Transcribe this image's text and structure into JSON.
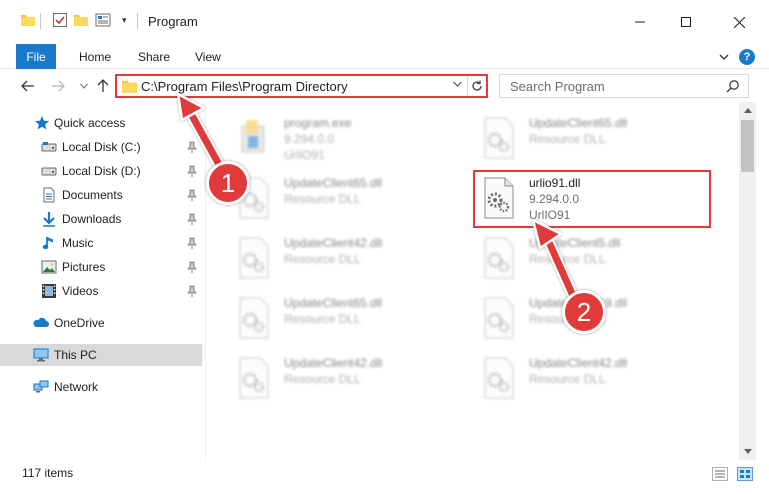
{
  "titlebar": {
    "title": "Program",
    "quick_access_dropdown": "▾"
  },
  "ribbon": {
    "tabs": [
      {
        "label": "File"
      },
      {
        "label": "Home"
      },
      {
        "label": "Share"
      },
      {
        "label": "View"
      }
    ],
    "help": "?"
  },
  "addressbar": {
    "path": "C:\\Program Files\\Program Directory",
    "search_placeholder": "Search Program"
  },
  "sidebar": {
    "items": [
      {
        "label": "Quick access",
        "icon": "star-icon"
      },
      {
        "label": "Local Disk (C:)",
        "icon": "drive-icon",
        "pinned": true
      },
      {
        "label": "Local Disk (D:)",
        "icon": "drive-icon",
        "pinned": true
      },
      {
        "label": "Documents",
        "icon": "documents-icon",
        "pinned": true
      },
      {
        "label": "Downloads",
        "icon": "downloads-icon",
        "pinned": true
      },
      {
        "label": "Music",
        "icon": "music-icon",
        "pinned": true
      },
      {
        "label": "Pictures",
        "icon": "pictures-icon",
        "pinned": true
      },
      {
        "label": "Videos",
        "icon": "videos-icon",
        "pinned": true
      },
      {
        "label": "OneDrive",
        "icon": "onedrive-icon"
      },
      {
        "label": "This PC",
        "icon": "this-pc-icon",
        "selected": true
      },
      {
        "label": "Network",
        "icon": "network-icon"
      }
    ]
  },
  "files": [
    {
      "name": "program.exe",
      "line2": "9.294.0.0",
      "line3": "UrllO91",
      "type": "exe"
    },
    {
      "name": "UpdateClient65.dll",
      "line2": "Resource DLL",
      "line3": "",
      "type": "dll"
    },
    {
      "name": "UpdateClient65.dll",
      "line2": "Resource DLL",
      "line3": "",
      "type": "dll"
    },
    {
      "name": "urlio91.dll",
      "line2": "9.294.0.0",
      "line3": "UrlIO91",
      "type": "dll",
      "highlighted": true
    },
    {
      "name": "UpdateClient42.dll",
      "line2": "Resource DLL",
      "line3": "",
      "type": "dll"
    },
    {
      "name": "UpdateClient5.dll",
      "line2": "Resource DLL",
      "line3": "",
      "type": "dll"
    },
    {
      "name": "UpdateClient65.dll",
      "line2": "Resource DLL",
      "line3": "",
      "type": "dll"
    },
    {
      "name": "UpdateClient19.dll",
      "line2": "Resource DLL",
      "line3": "",
      "type": "dll"
    },
    {
      "name": "UpdateClient42.dll",
      "line2": "Resource DLL",
      "line3": "",
      "type": "dll"
    },
    {
      "name": "UpdateClient42.dll",
      "line2": "Resource DLL",
      "line3": "",
      "type": "dll"
    }
  ],
  "statusbar": {
    "count": "117 items"
  },
  "annotations": {
    "step1": "1",
    "step2": "2",
    "color": "#e03a3a"
  }
}
